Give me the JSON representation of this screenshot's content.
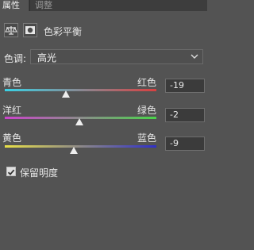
{
  "tabs": [
    {
      "label": "属性"
    },
    {
      "label": "调整"
    }
  ],
  "header": {
    "title": "色彩平衡"
  },
  "tone": {
    "label": "色调:",
    "value": "高光"
  },
  "sliders": [
    {
      "left": "青色",
      "right": "红色",
      "value": "-19",
      "level": -19
    },
    {
      "left": "洋红",
      "right": "绿色",
      "value": "-2",
      "level": -2
    },
    {
      "left": "黄色",
      "right": "蓝色",
      "value": "-9",
      "level": -9
    }
  ],
  "preserve": {
    "label": "保留明度",
    "checked": true
  },
  "colors": {
    "panel": "#535353",
    "tabbar": "#3d3d3d",
    "cyan": "#39d2e6",
    "red": "#d84040",
    "magenta": "#cc44cc",
    "green": "#4ad44a",
    "yellow": "#e8e048",
    "blue": "#3030c8"
  }
}
